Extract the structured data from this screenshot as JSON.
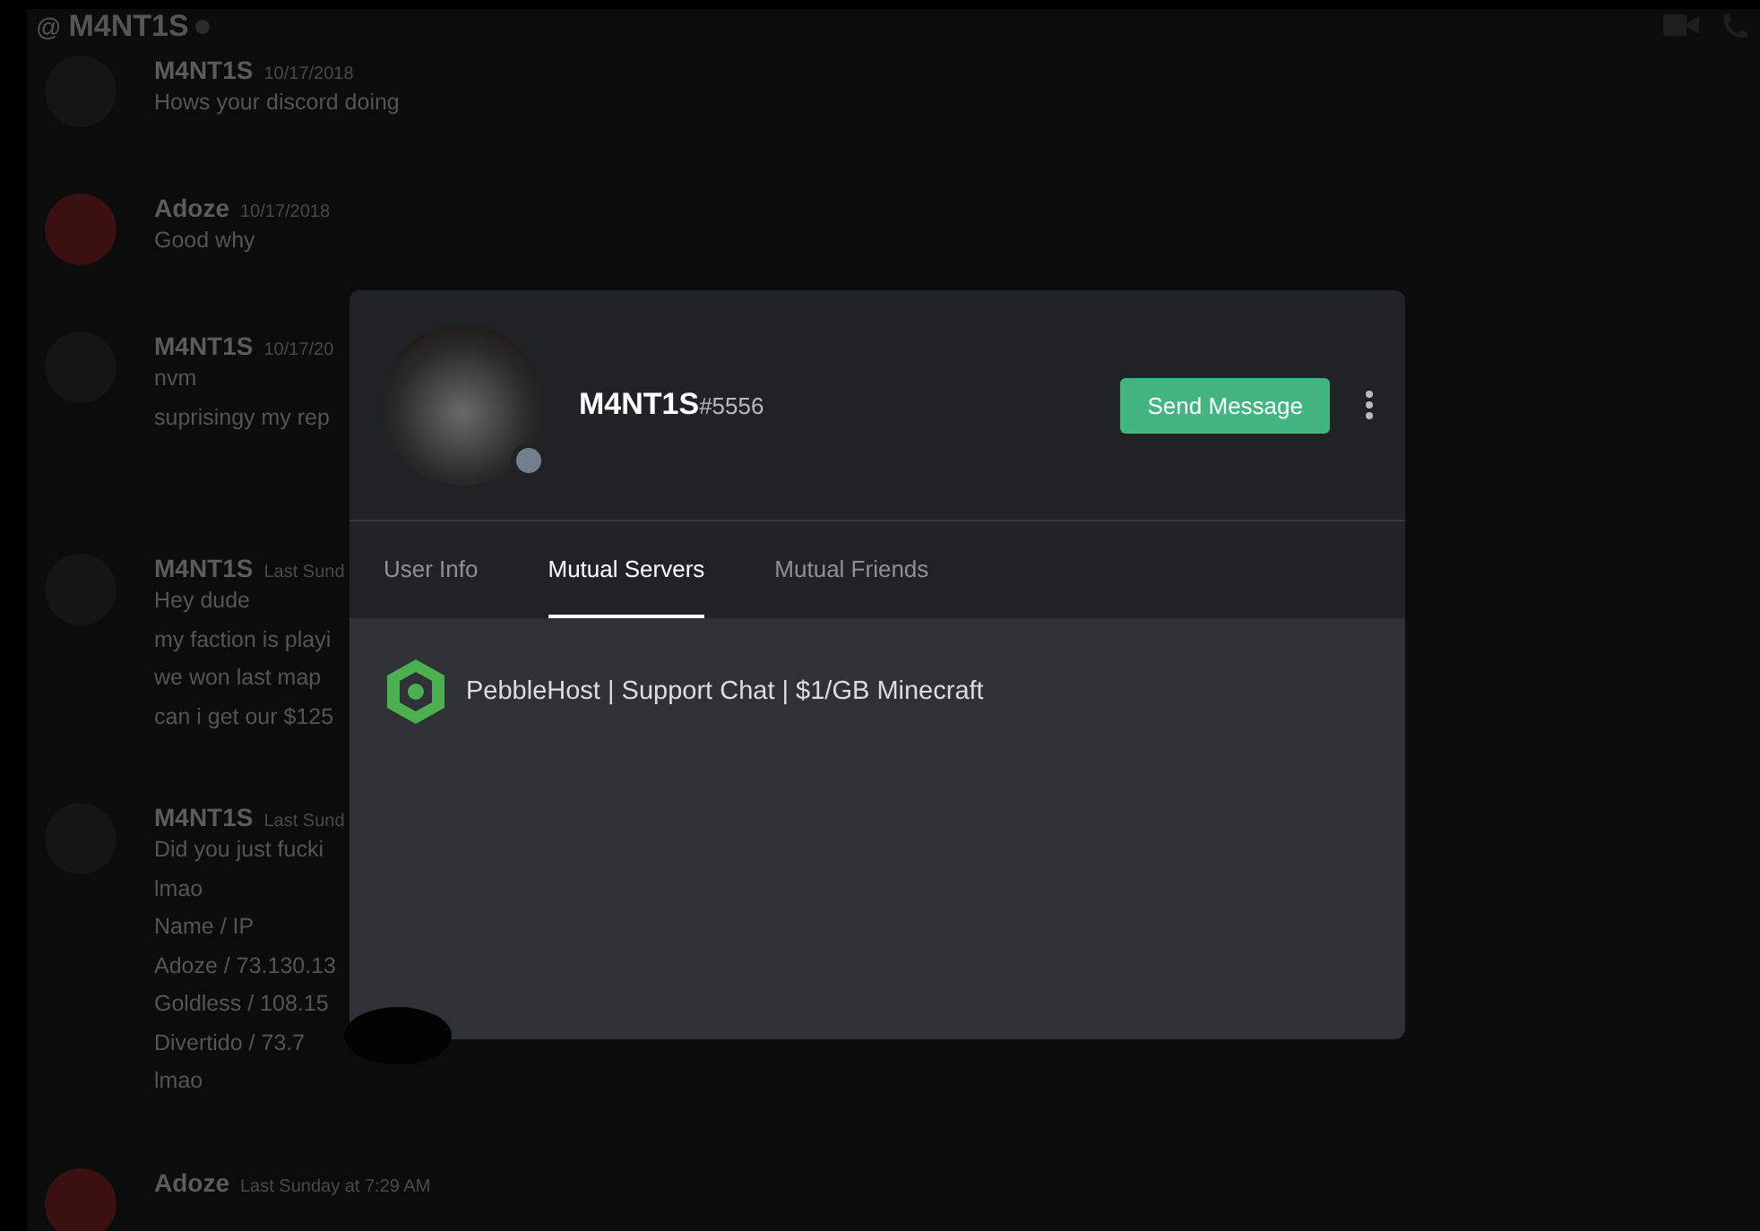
{
  "channel_header": {
    "symbol": "@",
    "name": "M4NT1S"
  },
  "messages": [
    {
      "author": "M4NT1S",
      "timestamp": "10/17/2018",
      "color": "#151515",
      "lines": [
        "Hows your discord doing"
      ]
    },
    {
      "author": "Adoze",
      "timestamp": "10/17/2018",
      "color": "#3a1010",
      "lines": [
        "Good why"
      ]
    },
    {
      "author": "M4NT1S",
      "timestamp": "10/17/20",
      "color": "#151515",
      "lines": [
        "nvm",
        "suprisingy my rep"
      ]
    },
    {
      "author": "M4NT1S",
      "timestamp": "Last Sund",
      "color": "#151515",
      "lines": [
        "Hey dude",
        "my faction is playi",
        "we won last map",
        "can i get our $125"
      ]
    },
    {
      "author": "M4NT1S",
      "timestamp": "Last Sund",
      "color": "#151515",
      "lines": [
        "Did you just fucki",
        "lmao",
        "Name / IP",
        "Adoze / 73.130.13",
        "Goldless / 108.15",
        "Divertido / 73.7",
        "lmao"
      ]
    },
    {
      "author": "Adoze",
      "timestamp": "Last Sunday at 7:29 AM",
      "color": "#3a1010"
    }
  ],
  "profile_modal": {
    "username": "M4NT1S",
    "discriminator": "#5556",
    "send_button": "Send Message",
    "tabs": [
      {
        "label": "User Info",
        "selected": false
      },
      {
        "label": "Mutual Servers",
        "selected": true
      },
      {
        "label": "Mutual Friends",
        "selected": false
      }
    ],
    "mutual_servers": [
      {
        "name": "PebbleHost | Support Chat | $1/GB Minecraft"
      }
    ]
  }
}
